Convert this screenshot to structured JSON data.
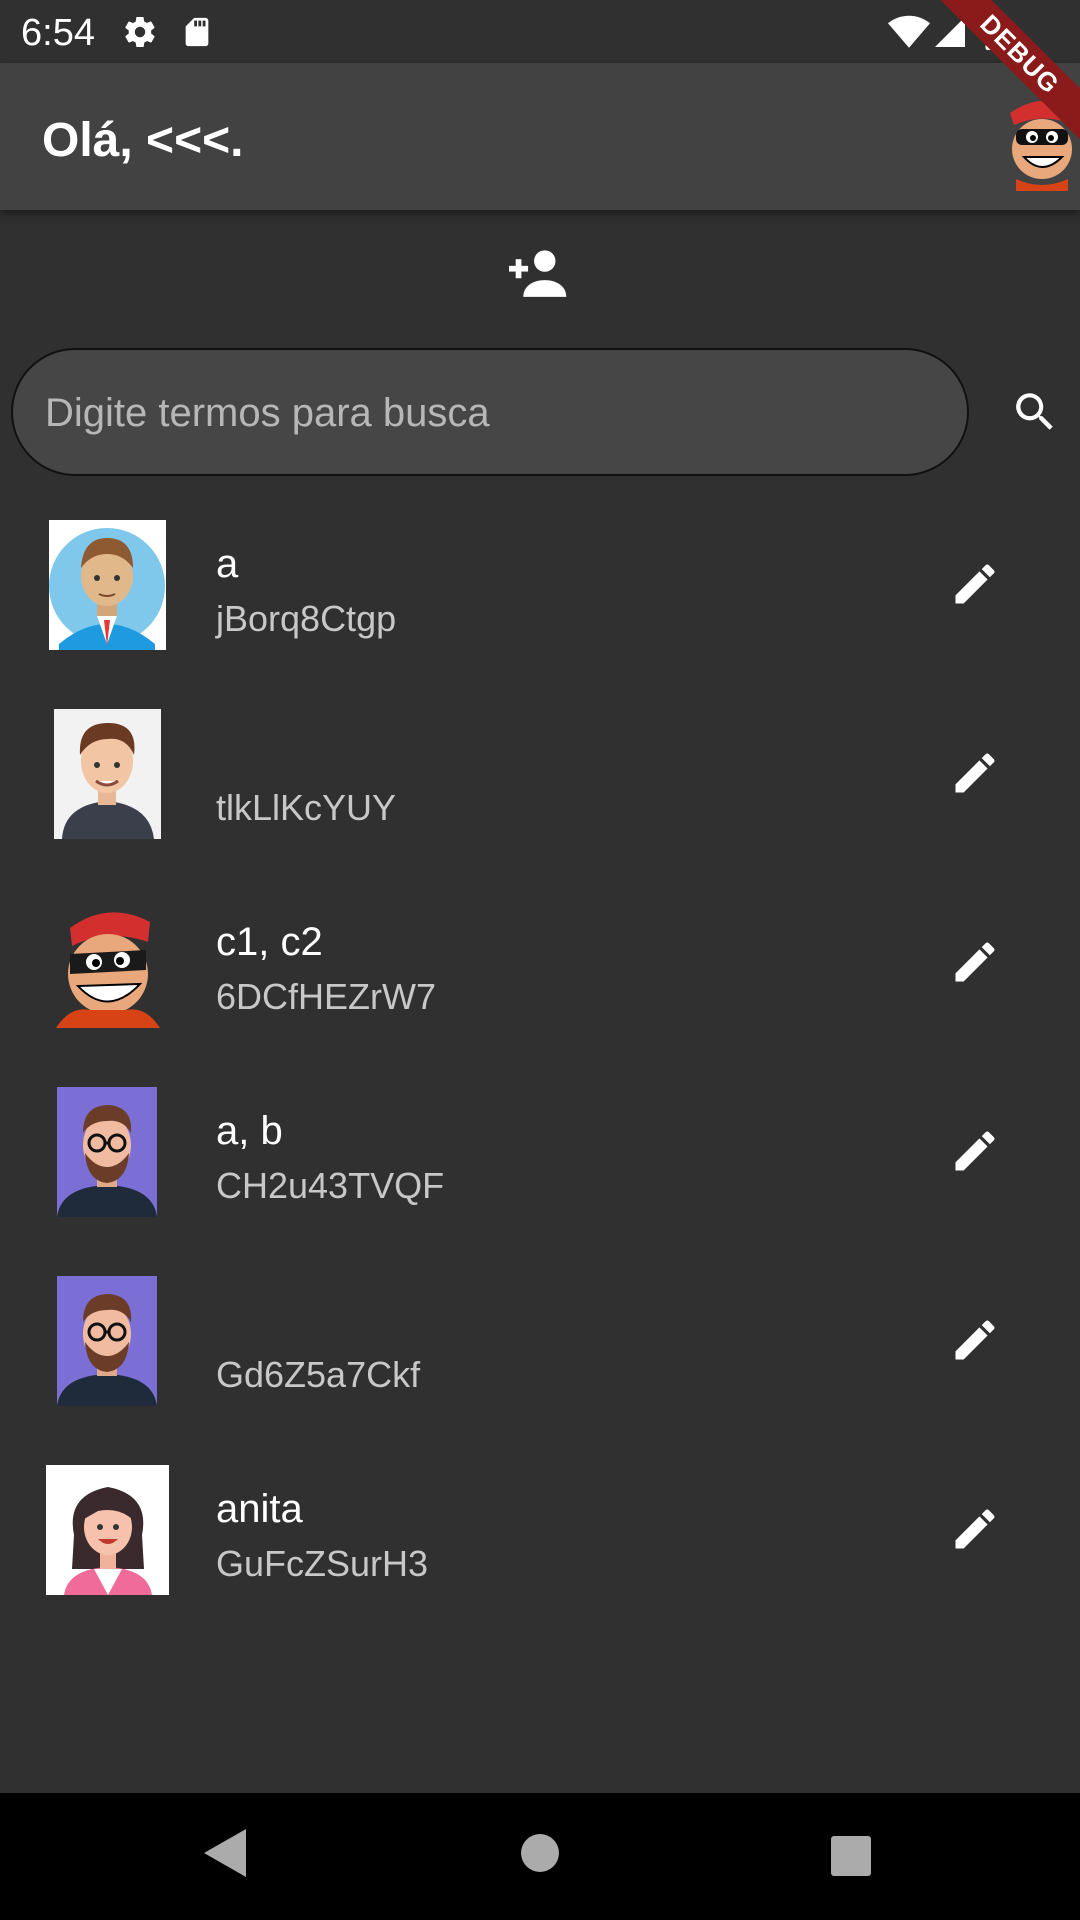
{
  "status_bar": {
    "time": "6:54",
    "icons": [
      "gear-icon",
      "sd-card-icon",
      "wifi-icon",
      "signal-icon",
      "battery-icon"
    ]
  },
  "app_bar": {
    "title": "Olá, <<<.",
    "debug_label": "DEBUG",
    "avatar": "cartoon-avatar"
  },
  "actions": {
    "add_user_icon": "person-add-icon"
  },
  "search": {
    "placeholder": "Digite termos para busca",
    "value": "",
    "icon": "search-icon"
  },
  "contacts": [
    {
      "name": "a",
      "id": "jBorq8Ctgp",
      "avatar": "man-blue-shirt-avatar"
    },
    {
      "name": "",
      "id": "tlkLlKcYUY",
      "avatar": "man-grey-shirt-avatar"
    },
    {
      "name": "c1, c2",
      "id": "6DCfHEZrW7",
      "avatar": "cartoon-avatar"
    },
    {
      "name": "a, b",
      "id": "CH2u43TVQF",
      "avatar": "bearded-man-avatar"
    },
    {
      "name": "",
      "id": "Gd6Z5a7Ckf",
      "avatar": "bearded-man-avatar"
    },
    {
      "name": "anita",
      "id": "GuFcZSurH3",
      "avatar": "woman-avatar"
    }
  ],
  "nav_bar": {
    "buttons": [
      "back-icon",
      "home-icon",
      "recents-icon"
    ]
  },
  "colors": {
    "background": "#303030",
    "app_bar": "#424242",
    "search_field": "#464646",
    "debug_banner": "#8b1a1a",
    "secondary_text": "#c8c8c8"
  }
}
